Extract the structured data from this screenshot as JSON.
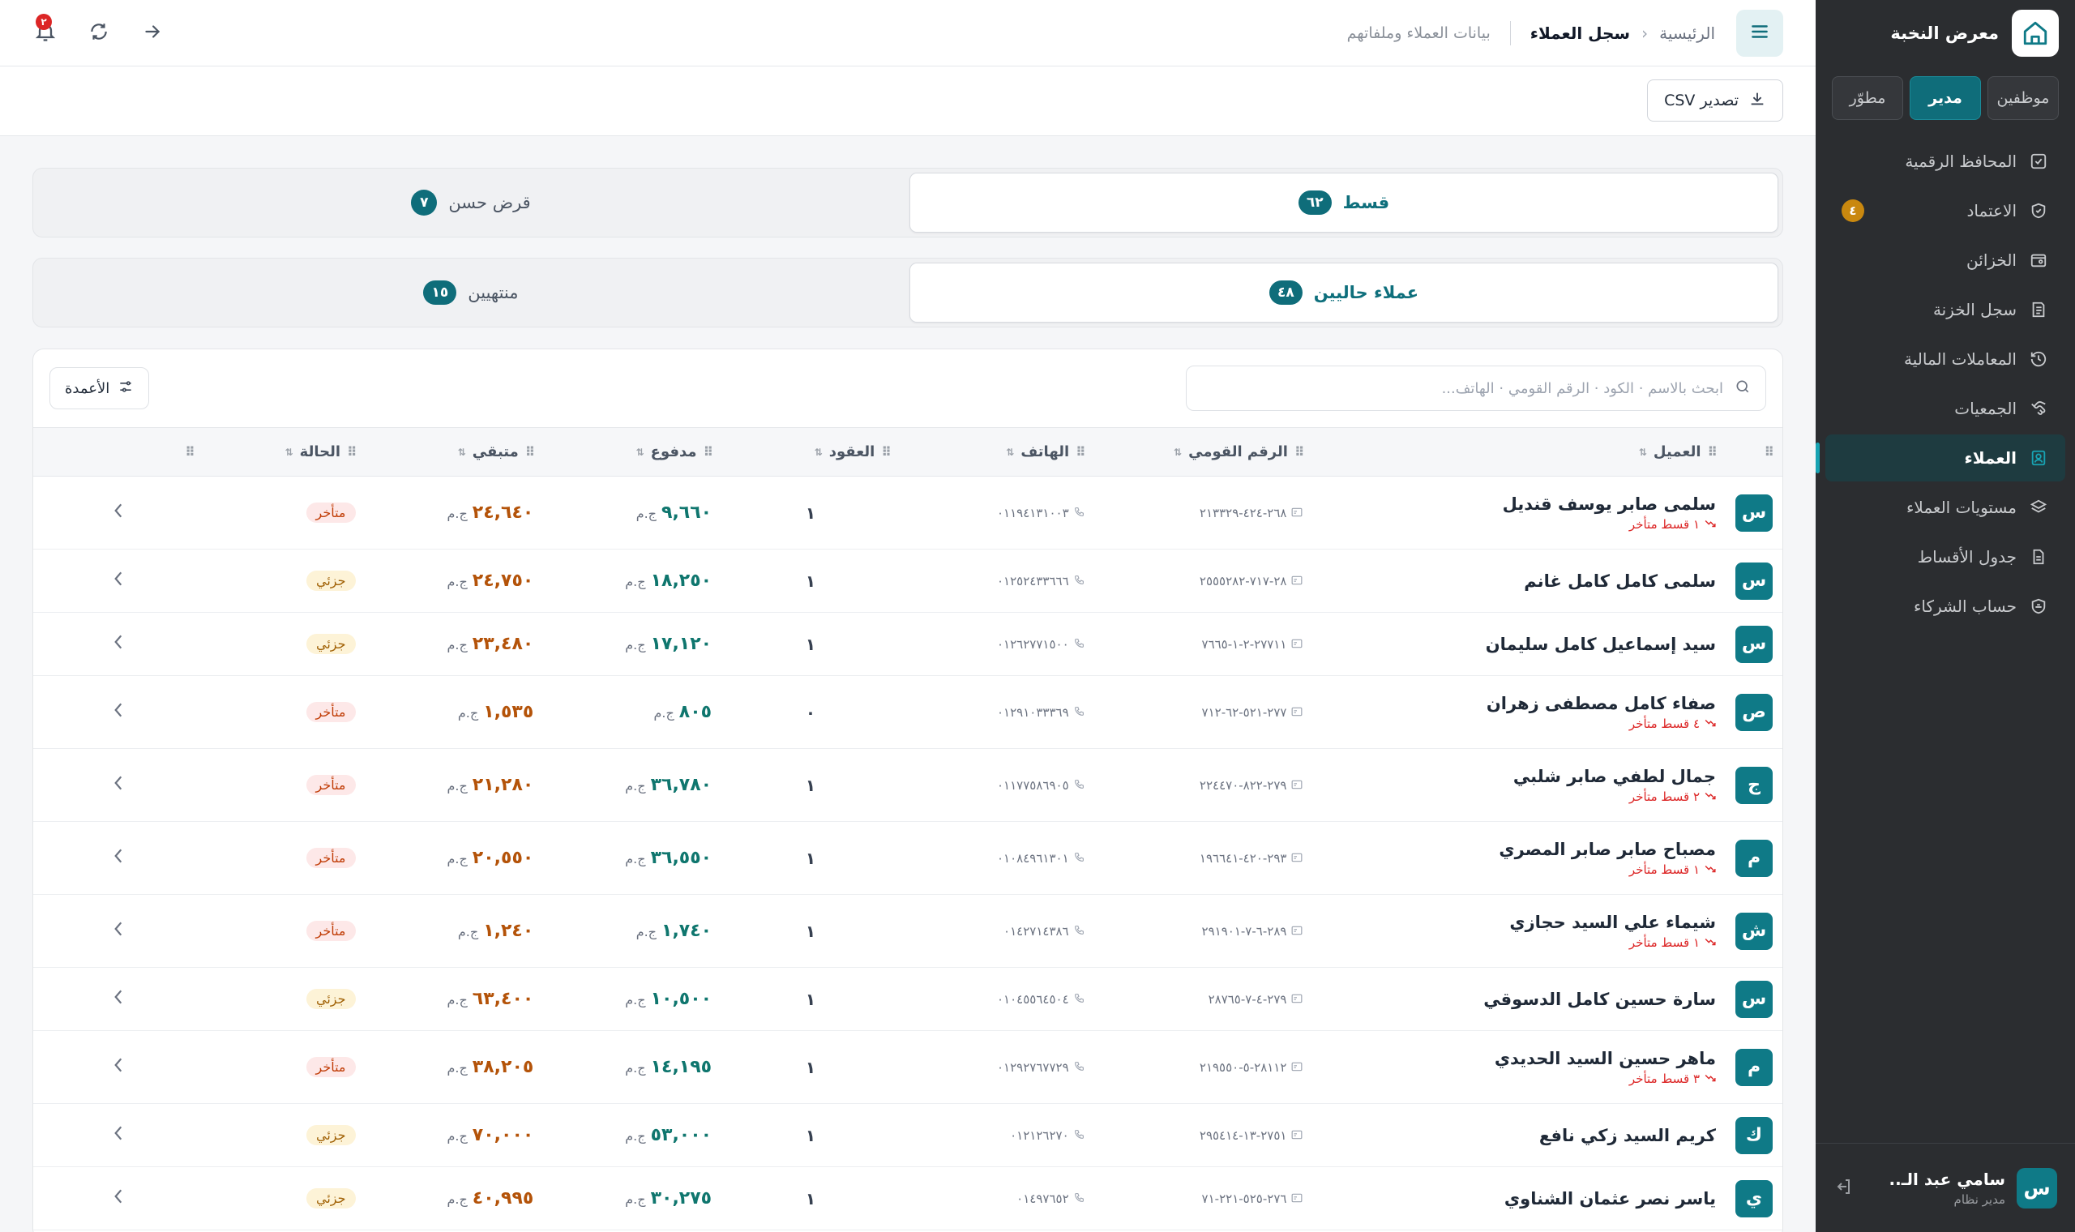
{
  "app": {
    "brand": "معرض النخبة",
    "roles": [
      {
        "label": "موظفين",
        "active": false
      },
      {
        "label": "مدير",
        "active": true
      },
      {
        "label": "مطوّر",
        "active": false
      }
    ]
  },
  "sidebar": {
    "items": [
      {
        "label": "المحافظ الرقمية",
        "icon": "checklist-icon",
        "active": false,
        "badge": ""
      },
      {
        "label": "الاعتماد",
        "icon": "shield-check-icon",
        "active": false,
        "badge": "٤"
      },
      {
        "label": "الخزائن",
        "icon": "safe-icon",
        "active": false,
        "badge": ""
      },
      {
        "label": "سجل الخزنة",
        "icon": "ledger-icon",
        "active": false,
        "badge": ""
      },
      {
        "label": "المعاملات المالية",
        "icon": "history-icon",
        "active": false,
        "badge": ""
      },
      {
        "label": "الجمعيات",
        "icon": "handshake-icon",
        "active": false,
        "badge": ""
      },
      {
        "label": "العملاء",
        "icon": "contact-card-icon",
        "active": true,
        "badge": ""
      },
      {
        "label": "مستويات العملاء",
        "icon": "layers-icon",
        "active": false,
        "badge": ""
      },
      {
        "label": "جدول الأقساط",
        "icon": "document-icon",
        "active": false,
        "badge": ""
      },
      {
        "label": "حساب الشركاء",
        "icon": "partners-icon",
        "active": false,
        "badge": ""
      }
    ],
    "user": {
      "initial": "س",
      "name": "سامي عبد الـ..",
      "role": "مدير نظام"
    }
  },
  "header": {
    "breadcrumb_home": "الرئيسية",
    "breadcrumb_current": "سجل العملاء",
    "subtitle": "بيانات العملاء وملفاتهم",
    "notification_count": "٢"
  },
  "toolbar": {
    "export_label": "تصدير CSV"
  },
  "type_tabs": [
    {
      "label": "قسط",
      "count": "٦٢",
      "active": true
    },
    {
      "label": "قرض حسن",
      "count": "٧",
      "active": false
    }
  ],
  "status_tabs": [
    {
      "label": "عملاء حاليين",
      "count": "٤٨",
      "active": true
    },
    {
      "label": "منتهيين",
      "count": "١٥",
      "active": false
    }
  ],
  "table": {
    "search_placeholder": "ابحث بالاسم · الكود · الرقم القومي · الهاتف...",
    "columns_button": "الأعمدة",
    "columns": [
      "العميل",
      "الرقم القومي",
      "الهاتف",
      "العقود",
      "مدفوع",
      "متبقي",
      "الحالة"
    ],
    "currency": "ج.م",
    "rows": [
      {
        "initial": "س",
        "name": "سلمى صابر يوسف قنديل",
        "late": "١ قسط متأخر",
        "national_id": "٢٦٨-٤٢٤-٢١٣٣٢٩",
        "phone": "٠١١٩٤١٣١٠٠٣",
        "contracts": "١",
        "paid": "٩,٦٦٠",
        "remaining": "٢٤,٦٤٠",
        "status": "متأخر",
        "status_type": "late"
      },
      {
        "initial": "س",
        "name": "سلمى كامل كامل غانم",
        "late": "",
        "national_id": "٢٨-٧١٧-٢٥٥٥٢٨٢",
        "phone": "٠١٢٥٢٤٣٣٦٦٦",
        "contracts": "١",
        "paid": "١٨,٢٥٠",
        "remaining": "٢٤,٧٥٠",
        "status": "جزئي",
        "status_type": "partial"
      },
      {
        "initial": "س",
        "name": "سيد إسماعيل كامل سليمان",
        "late": "",
        "national_id": "٢٧٧١١-٢-١-٧٦٦٥",
        "phone": "٠١٢٦٢٧٧١٥٠٠",
        "contracts": "١",
        "paid": "١٧,١٢٠",
        "remaining": "٢٣,٤٨٠",
        "status": "جزئي",
        "status_type": "partial"
      },
      {
        "initial": "ص",
        "name": "صفاء كامل مصطفى زهران",
        "late": "٤ قسط متأخر",
        "national_id": "٢٧٧-٥٢١-٦٢-٧١٢",
        "phone": "٠١٢٩١٠٣٣٣٦٩",
        "contracts": "٠",
        "paid": "٨٠٥",
        "remaining": "١,٥٣٥",
        "status": "متأخر",
        "status_type": "late"
      },
      {
        "initial": "ج",
        "name": "جمال لطفي صابر شلبي",
        "late": "٢ قسط متأخر",
        "national_id": "٢٧٩-٨٢٢-٢٢٤٤٧٠",
        "phone": "٠١١٧٧٥٨٦٩٠٥",
        "contracts": "١",
        "paid": "٣٦,٧٨٠",
        "remaining": "٢١,٢٨٠",
        "status": "متأخر",
        "status_type": "late"
      },
      {
        "initial": "م",
        "name": "مصباح صابر صابر المصري",
        "late": "١ قسط متأخر",
        "national_id": "٢٩٣-٤٢٠-١٩٦٦٤١",
        "phone": "٠١٠٨٤٩٦١٣٠١",
        "contracts": "١",
        "paid": "٣٦,٥٥٠",
        "remaining": "٢٠,٥٥٠",
        "status": "متأخر",
        "status_type": "late"
      },
      {
        "initial": "ش",
        "name": "شيماء علي السيد حجازي",
        "late": "١ قسط متأخر",
        "national_id": "٢٨٩-٦-٧-٢٩١٩٠١",
        "phone": "٠١٤٢٧١٤٣٨٦",
        "contracts": "١",
        "paid": "١,٧٤٠",
        "remaining": "١,٢٤٠",
        "status": "متأخر",
        "status_type": "late"
      },
      {
        "initial": "س",
        "name": "سارة حسين كامل الدسوقي",
        "late": "",
        "national_id": "٢٧٩-٤-٧-٢٨٧٦٥",
        "phone": "٠١٠٤٥٥٦٤٥٠٤",
        "contracts": "١",
        "paid": "١٠,٥٠٠",
        "remaining": "٦٣,٤٠٠",
        "status": "جزئي",
        "status_type": "partial"
      },
      {
        "initial": "م",
        "name": "ماهر حسين السيد الحديدي",
        "late": "٣ قسط متأخر",
        "national_id": "٢٨١١٢-٥-٢١٩٥٥٠",
        "phone": "٠١٢٩٢٧٦٧٧٢٩",
        "contracts": "١",
        "paid": "١٤,١٩٥",
        "remaining": "٣٨,٢٠٥",
        "status": "متأخر",
        "status_type": "late"
      },
      {
        "initial": "ك",
        "name": "كريم السيد زكي نافع",
        "late": "",
        "national_id": "٢٧٥١-١٣-٢٩٥٤١٤",
        "phone": "٠١٢١٢٦٢٧٠",
        "contracts": "١",
        "paid": "٥٣,٠٠٠",
        "remaining": "٧٠,٠٠٠",
        "status": "جزئي",
        "status_type": "partial"
      },
      {
        "initial": "ي",
        "name": "ياسر نصر عثمان الشناوي",
        "late": "",
        "national_id": "٢٧٦-٥٢٥-٢٢١-٧١",
        "phone": "٠١٤٩٧٦٥٢",
        "contracts": "١",
        "paid": "٣٠,٢٧٥",
        "remaining": "٤٠,٩٩٥",
        "status": "جزئي",
        "status_type": "partial"
      }
    ]
  },
  "colors": {
    "accent": "#0f6d7a",
    "sidebar_bg": "#2b2d30",
    "paid": "#0f766e",
    "remaining": "#b45309",
    "late": "#dc2626"
  }
}
